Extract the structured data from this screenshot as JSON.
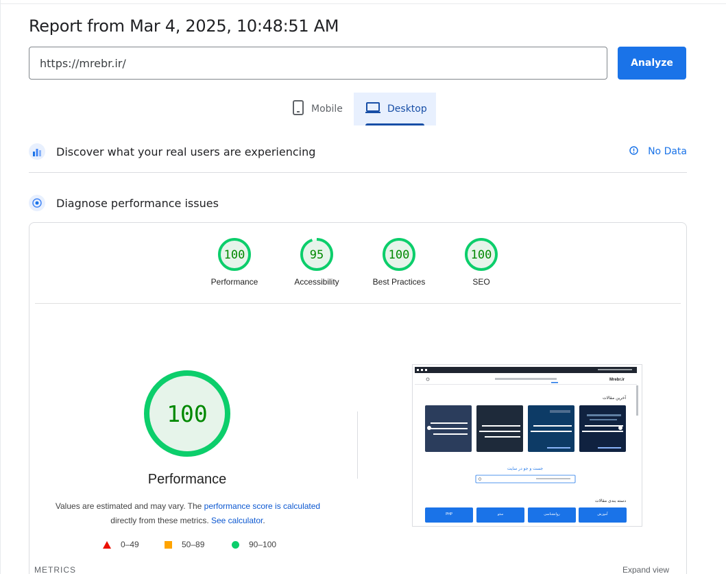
{
  "report": {
    "title": "Report from Mar 4, 2025, 10:48:51 AM"
  },
  "url_bar": {
    "value": "https://mrebr.ir/"
  },
  "analyze_label": "Analyze",
  "tabs": [
    {
      "label": "Mobile",
      "selected": false
    },
    {
      "label": "Desktop",
      "selected": true
    }
  ],
  "real_users": {
    "title": "Discover what your real users are experiencing",
    "status": "No Data"
  },
  "diagnose": {
    "title": "Diagnose performance issues"
  },
  "scores": [
    {
      "label": "Performance",
      "value": "100",
      "fraction": 1.0
    },
    {
      "label": "Accessibility",
      "value": "95",
      "fraction": 0.95
    },
    {
      "label": "Best Practices",
      "value": "100",
      "fraction": 1.0
    },
    {
      "label": "SEO",
      "value": "100",
      "fraction": 1.0
    }
  ],
  "performance": {
    "score": "100",
    "title": "Performance",
    "desc_part1": "Values are estimated and may vary. The ",
    "desc_link1": "performance score is calculated",
    "desc_part2": "directly from these metrics. ",
    "desc_link2": "See calculator",
    "desc_part3": "."
  },
  "legend": {
    "fail": "0–49",
    "average": "50–89",
    "pass": "90–100"
  },
  "colors": {
    "pass": "#0cce6b",
    "pass_text": "#008800",
    "pass_fill": "#e6f4ea",
    "average": "#ffa400",
    "fail": "#eb0f00",
    "accent": "#1a73e8"
  },
  "screenshot": {
    "site_name": "Mrebr.ir",
    "latest_heading": "آخرین مقالات",
    "search_heading": "جست و جو در سایت",
    "categories_heading": "دسته بندی مقالات",
    "category_buttons": [
      "آموزش",
      "روانشناسی",
      "سئو",
      "PHP"
    ]
  },
  "metrics_label": "METRICS",
  "expand_view": "Expand view"
}
